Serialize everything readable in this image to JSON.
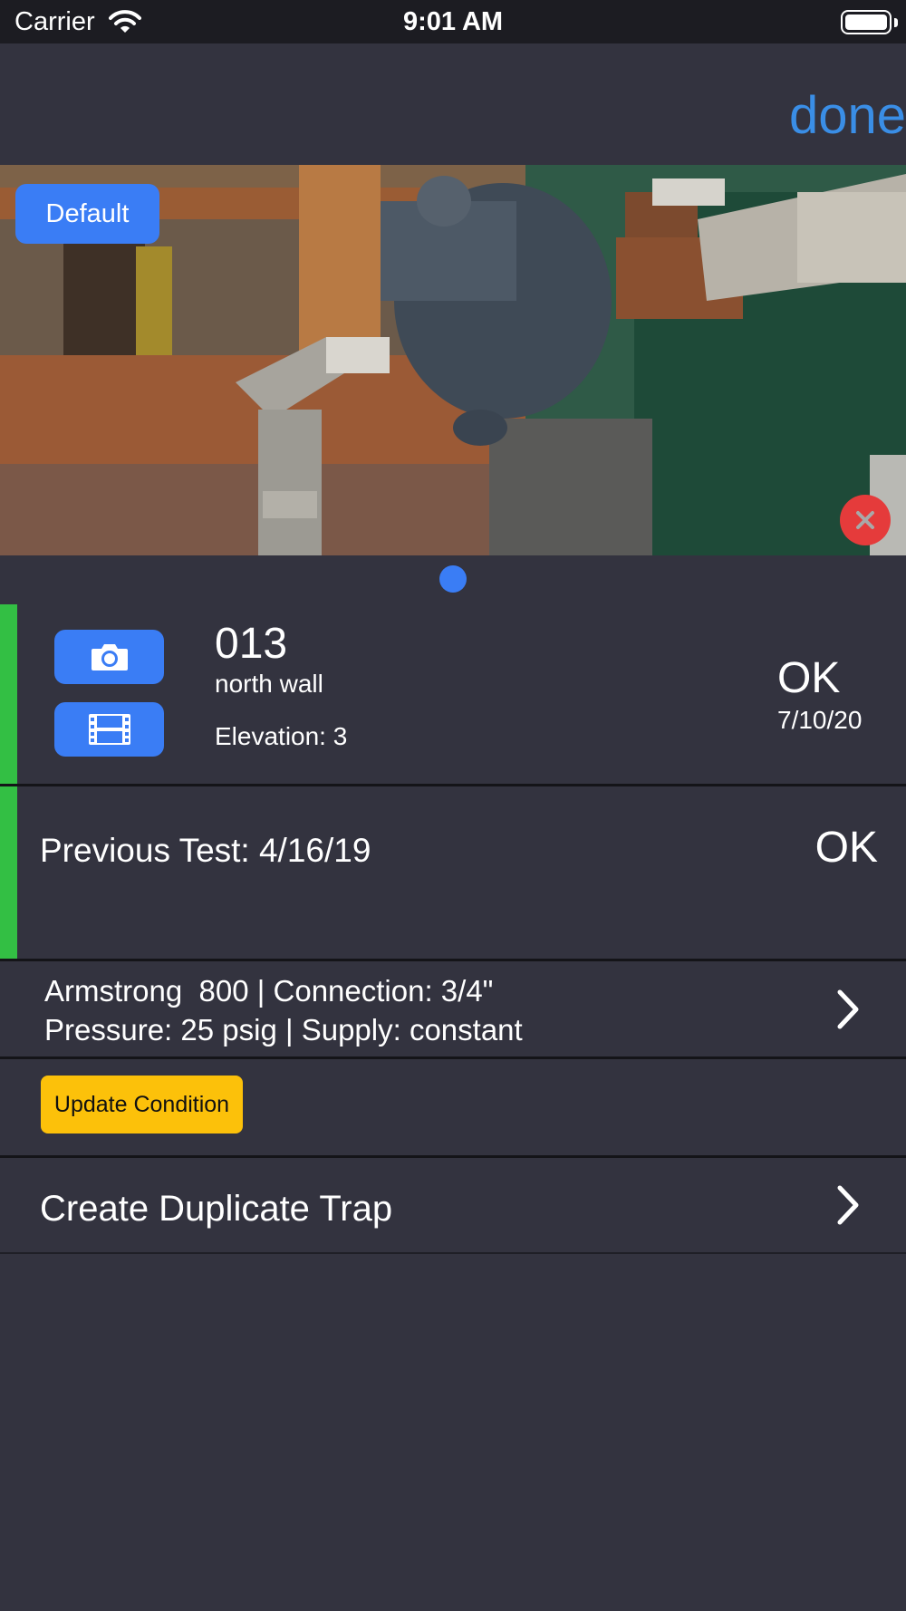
{
  "status_bar": {
    "carrier": "Carrier",
    "time": "9:01 AM"
  },
  "nav": {
    "done_label": "done"
  },
  "photo": {
    "default_label": "Default",
    "page_count": 1,
    "current_page": 1
  },
  "trap": {
    "id": "013",
    "location": "north wall",
    "elevation": "Elevation: 3",
    "status": "OK",
    "date": "7/10/20",
    "status_color": "#33bf44"
  },
  "previous_test": {
    "label": "Previous Test: 4/16/19",
    "status": "OK"
  },
  "specs": {
    "line1": "Armstrong  800 | Connection: 3/4\"",
    "line2": "Pressure: 25 psig | Supply: constant"
  },
  "actions": {
    "update_condition_label": "Update Condition",
    "create_duplicate_label": "Create Duplicate Trap"
  },
  "colors": {
    "accent_blue": "#3a7df5",
    "done_blue": "#3a8ee6",
    "status_green": "#33bf44",
    "warning_yellow": "#fcc10a",
    "delete_red": "#e53b3b",
    "background": "#33333f"
  }
}
